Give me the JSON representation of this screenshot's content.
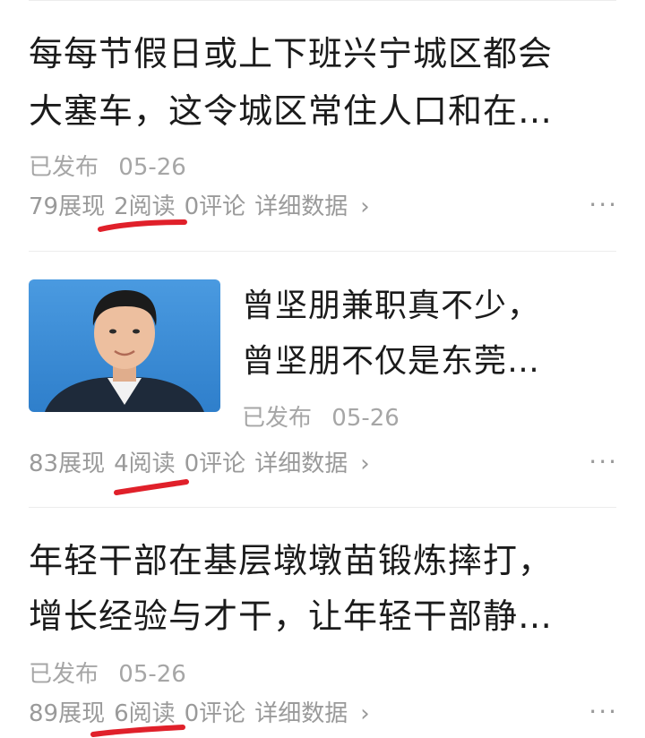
{
  "articles": [
    {
      "title_line1": "每每节假日或上下班兴宁城区都会",
      "title_line2": "大塞车，这令城区常住人口和在…",
      "status": "已发布",
      "date": "05-26",
      "impressions": "79展现",
      "reads": "2阅读",
      "comments": "0评论",
      "detail": "详细数据",
      "more": "···"
    },
    {
      "title_line1": "曾坚朋兼职真不少，",
      "title_line2": "曾坚朋不仅是东莞…",
      "status": "已发布",
      "date": "05-26",
      "impressions": "83展现",
      "reads": "4阅读",
      "comments": "0评论",
      "detail": "详细数据",
      "more": "···"
    },
    {
      "title_line1": "年轻干部在基层墩墩苗锻炼摔打，",
      "title_line2": "增长经验与才干，让年轻干部静…",
      "status": "已发布",
      "date": "05-26",
      "impressions": "89展现",
      "reads": "6阅读",
      "comments": "0评论",
      "detail": "详细数据",
      "more": "···"
    }
  ],
  "colors": {
    "annotation": "#e0202a",
    "thumb_bg": "#3b8fd8"
  },
  "icons": {
    "chevron": "chevron-right-icon",
    "more": "more-options-icon"
  }
}
